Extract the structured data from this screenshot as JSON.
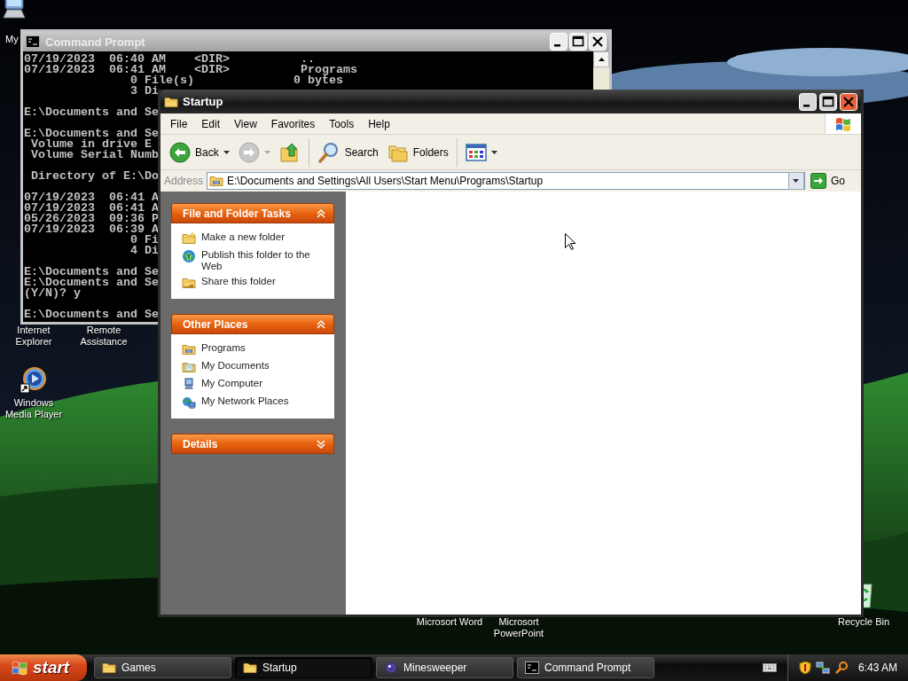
{
  "desktop_icons": [
    {
      "kind": "computer",
      "label": "My"
    },
    {
      "kind": "covered",
      "label": "Internet Explorer"
    },
    {
      "kind": "covered",
      "label": "Remote Assistance"
    },
    {
      "kind": "media-player",
      "label": "Windows Media Player"
    },
    {
      "kind": "covered",
      "label": "Microsort Word"
    },
    {
      "kind": "covered",
      "label": "Microsort PowerPoint"
    },
    {
      "kind": "recycle-bin",
      "label": "Recycle Bin"
    }
  ],
  "command_prompt": {
    "title": "Command Prompt",
    "active": false,
    "blocks": [
      [
        "07/19/2023  06:40 AM    <DIR>          ..",
        "07/19/2023  06:41 AM    <DIR>          Programs",
        "               0 File(s)              0 bytes",
        "               3 Di"
      ],
      [
        "E:\\Documents and Se"
      ],
      [
        "E:\\Documents and Se",
        " Volume in drive E",
        " Volume Serial Numb"
      ],
      [
        " Directory of E:\\Do"
      ],
      [
        "07/19/2023  06:41 A",
        "07/19/2023  06:41 A",
        "05/26/2023  09:36 P",
        "07/19/2023  06:39 A",
        "               0 Fi",
        "               4 Di"
      ],
      [
        "E:\\Documents and Se",
        "E:\\Documents and Se",
        "(Y/N)? y"
      ],
      [
        "E:\\Documents and Se"
      ]
    ]
  },
  "explorer": {
    "title": "Startup",
    "active": true,
    "menu": [
      "File",
      "Edit",
      "View",
      "Favorites",
      "Tools",
      "Help"
    ],
    "toolbar": [
      {
        "kind": "back",
        "label": "Back",
        "disabled": false
      },
      {
        "kind": "forward",
        "disabled": true
      },
      {
        "kind": "up",
        "disabled": false
      },
      {
        "kind": "search",
        "label": "Search",
        "disabled": false
      },
      {
        "kind": "folders",
        "label": "Folders",
        "disabled": false
      },
      {
        "kind": "views",
        "disabled": false
      }
    ],
    "address": {
      "label": "Address",
      "value": "E:\\Documents and Settings\\All Users\\Start Menu\\Programs\\Startup",
      "go": "Go"
    },
    "panels": [
      {
        "title": "File and Folder Tasks",
        "expanded": true,
        "items": [
          {
            "kind": "new-folder",
            "label": "Make a new folder"
          },
          {
            "kind": "publish",
            "label": "Publish this folder to the Web"
          },
          {
            "kind": "share",
            "label": "Share this folder"
          }
        ]
      },
      {
        "title": "Other Places",
        "expanded": true,
        "items": [
          {
            "kind": "programs",
            "label": "Programs"
          },
          {
            "kind": "documents",
            "label": "My Documents"
          },
          {
            "kind": "computer",
            "label": "My Computer"
          },
          {
            "kind": "network",
            "label": "My Network Places"
          }
        ]
      },
      {
        "title": "Details",
        "expanded": false
      }
    ]
  },
  "taskbar": {
    "start": "start",
    "buttons": [
      {
        "kind": "folder",
        "label": "Games",
        "selected": false
      },
      {
        "kind": "folder",
        "label": "Startup",
        "selected": true
      },
      {
        "kind": "mine",
        "label": "Minesweeper",
        "selected": false
      },
      {
        "kind": "console",
        "label": "Command Prompt",
        "selected": false
      }
    ],
    "clock": "6:43 AM"
  }
}
